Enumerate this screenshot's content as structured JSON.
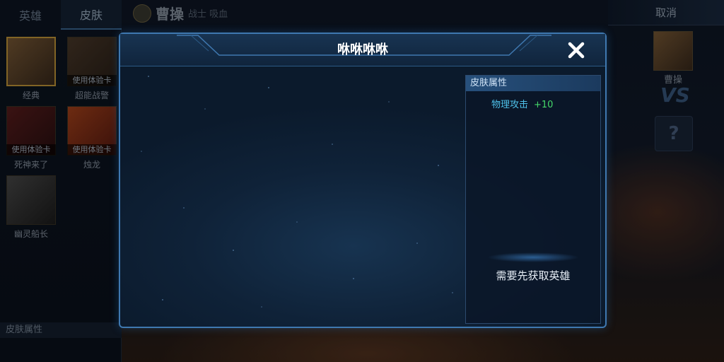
{
  "background": {
    "tabs": {
      "hero": "英雄",
      "skin": "皮肤"
    },
    "hero": {
      "name": "曹操",
      "role": "战士 吸血"
    },
    "skins": [
      {
        "name": "经典",
        "trial": ""
      },
      {
        "name": "超能战警",
        "trial": "使用体验卡"
      },
      {
        "name": "死神来了",
        "trial": "使用体验卡"
      },
      {
        "name": "烛龙",
        "trial": "使用体验卡"
      },
      {
        "name": "幽灵船长",
        "trial": ""
      }
    ],
    "left_footer": "皮肤属性",
    "cancel_label": "取消",
    "opponent_name": "曹操",
    "vs_label": "VS",
    "unknown_slot": "?"
  },
  "modal": {
    "title": "咻咻咻咻",
    "close_icon": "close-icon",
    "attributes": {
      "header": "皮肤属性",
      "items": [
        {
          "name": "物理攻击",
          "value": "+10"
        }
      ],
      "footer": "需要先获取英雄"
    },
    "colors": {
      "accent": "#3f78b0",
      "attr_name": "#4ec1ea",
      "attr_value": "#45d96a"
    }
  }
}
